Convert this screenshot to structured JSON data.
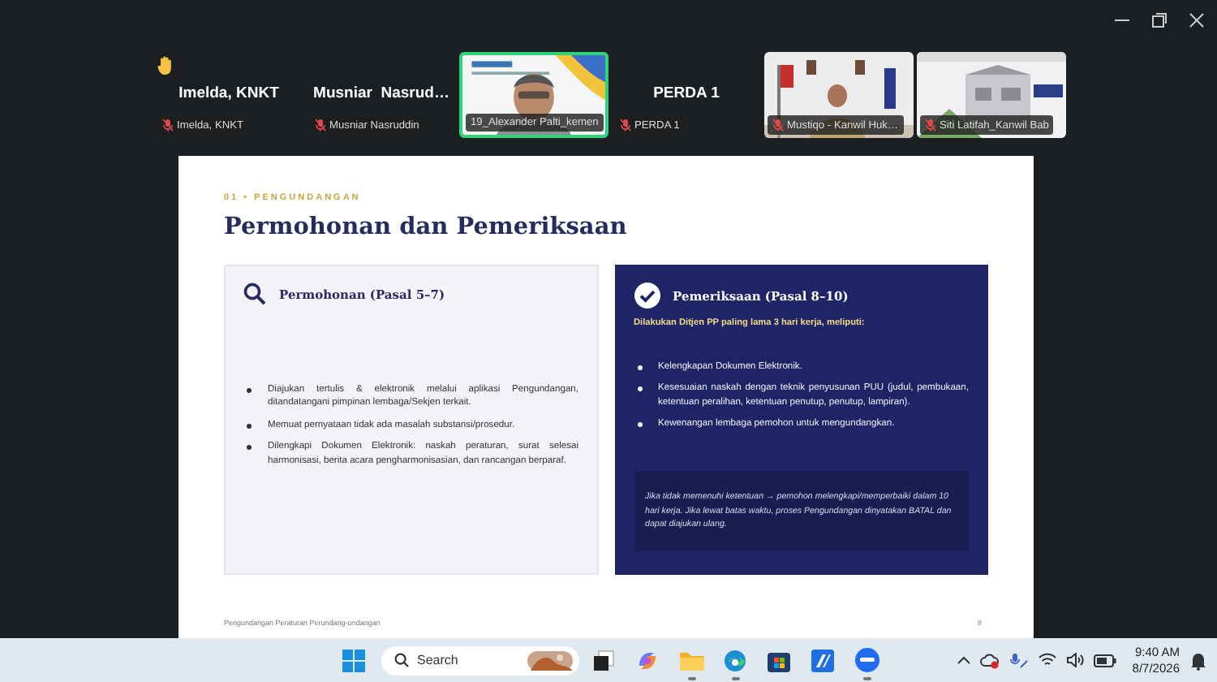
{
  "participants": [
    {
      "kind": "avatar",
      "tile_name": "Imelda, KNKT",
      "label": "Imelda, KNKT",
      "hand_raised": true,
      "muted": true,
      "active_speaker": false
    },
    {
      "kind": "avatar",
      "tile_name": "Musniar  Nasrud…",
      "label": "Musniar Nasruddin",
      "hand_raised": false,
      "muted": true,
      "active_speaker": false
    },
    {
      "kind": "video",
      "label": "19_Alexander Palti_kemen",
      "hand_raised": false,
      "muted": false,
      "active_speaker": true
    },
    {
      "kind": "avatar",
      "tile_name": "PERDA 1",
      "label": "PERDA 1",
      "hand_raised": false,
      "muted": true,
      "active_speaker": false
    },
    {
      "kind": "video",
      "label": "Mustiqo - Kanwil Huk…",
      "hand_raised": false,
      "muted": true,
      "active_speaker": false
    },
    {
      "kind": "video",
      "label": "Siti Latifah_Kanwil Bab",
      "hand_raised": false,
      "muted": true,
      "active_speaker": false
    }
  ],
  "slide": {
    "section": "01 • PENGUNDANGAN",
    "title": "Permohonan dan Pemeriksaan",
    "cards": [
      {
        "kind": "search",
        "heading": "Permohonan (Pasal 5–7)",
        "bullets": [
          "Diajukan tertulis & elektronik melalui aplikasi Pengundangan, ditandatangani pimpinan lembaga/Sekjen terkait.",
          "Memuat pernyataan tidak ada masalah substansi/prosedur.",
          "Dilengkapi Dokumen Elektronik: naskah peraturan, surat selesai harmonisasi, berita acara pengharmonisasian, dan rancangan berparaf."
        ]
      },
      {
        "kind": "check",
        "heading": "Pemeriksaan (Pasal 8–10)",
        "intro": "Dilakukan Ditjen PP paling lama 3 hari kerja, meliputi:",
        "bullets": [
          "Kelengkapan Dokumen Elektronik.",
          "Kesesuaian naskah dengan teknik penyusunan PUU (judul, pembukaan, ketentuan peralihan, ketentuan penutup, penutup, lampiran).",
          "Kewenangan lembaga pemohon untuk mengundangkan."
        ],
        "note": "Jika tidak memenuhi ketentuan → pemohon melengkapi/memperbaiki dalam 10 hari kerja. Jika lewat batas waktu, proses Pengundangan dinyatakan BATAL dan dapat diajukan ulang."
      }
    ],
    "footer": "Pengundangan Peraturan Perundang-undangan",
    "page": "8"
  },
  "taskbar": {
    "search_placeholder": "Search",
    "apps": [
      {
        "kind": "taskview",
        "running": false
      },
      {
        "kind": "copilot",
        "running": false
      },
      {
        "kind": "folder",
        "running": true
      },
      {
        "kind": "edge",
        "running": true
      },
      {
        "kind": "store",
        "running": false
      },
      {
        "kind": "editor",
        "running": false
      },
      {
        "kind": "zoom",
        "running": true
      }
    ],
    "time": "9:40 AM",
    "date": "8/7/2026"
  }
}
